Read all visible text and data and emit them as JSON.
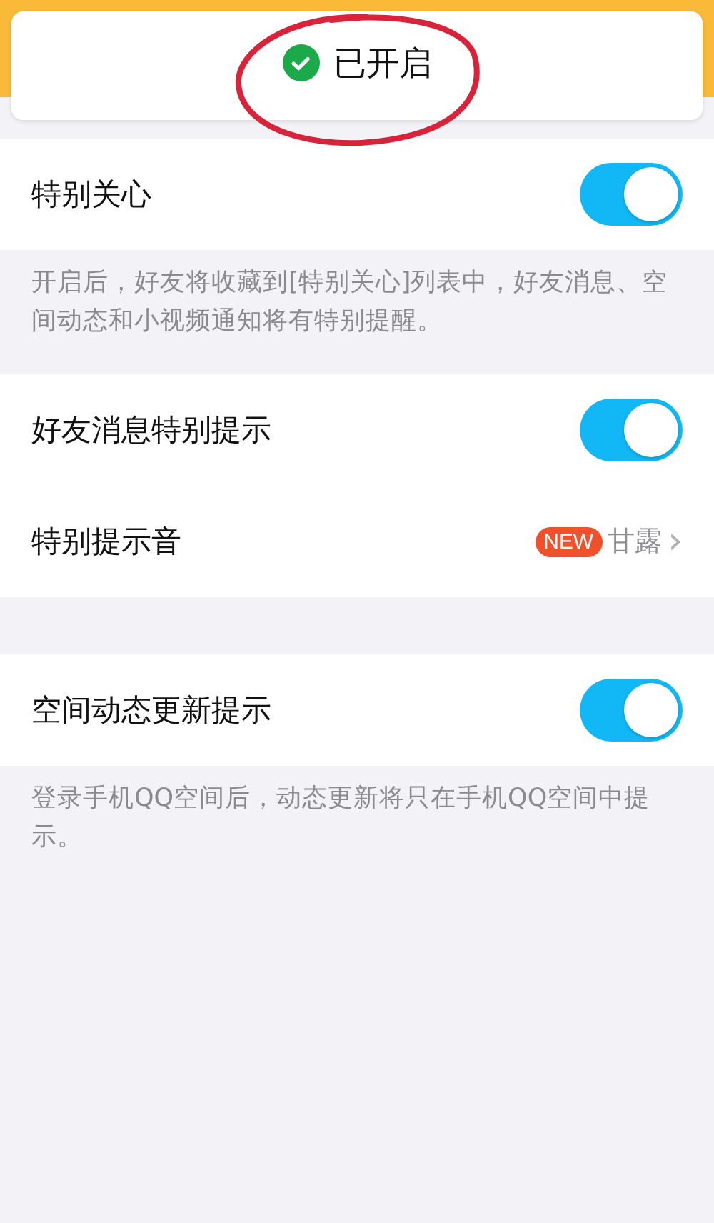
{
  "toast": {
    "kind": "success",
    "text": "已开启"
  },
  "annotation": {
    "kind": "circle"
  },
  "sections": [
    {
      "rows": [
        {
          "kind": "toggle",
          "label": "特别关心",
          "on": true
        }
      ],
      "note": "开启后，好友将收藏到[特别关心]列表中，好友消息、空间动态和小视频通知将有特别提醒。"
    },
    {
      "rows": [
        {
          "kind": "toggle",
          "label": "好友消息特别提示",
          "on": true
        },
        {
          "kind": "link",
          "label": "特别提示音",
          "badge": "NEW",
          "value": "甘露",
          "chevron": "›"
        }
      ]
    },
    {
      "rows": [
        {
          "kind": "toggle",
          "label": "空间动态更新提示",
          "on": true
        }
      ],
      "note": "登录手机QQ空间后，动态更新将只在手机QQ空间中提示。"
    }
  ]
}
